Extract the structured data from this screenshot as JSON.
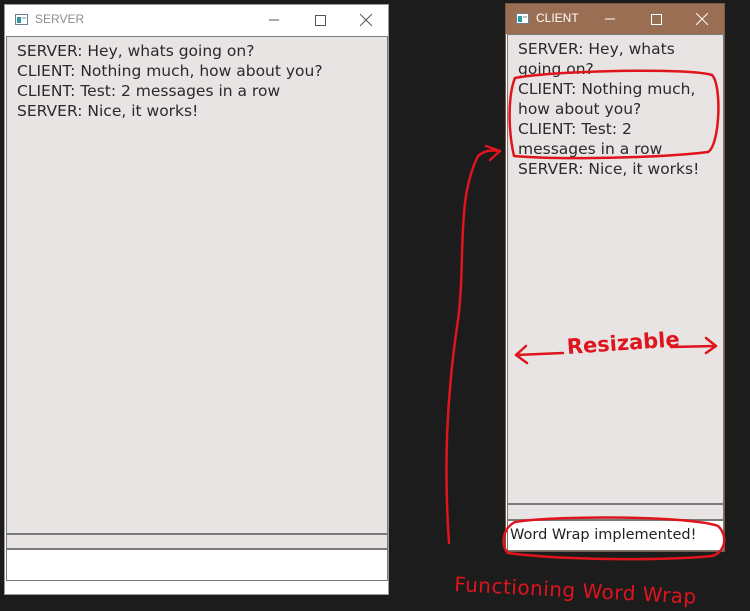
{
  "server_window": {
    "title": "SERVER",
    "messages": [
      "SERVER: Hey, whats going on?",
      "CLIENT: Nothing much, how about you?",
      "CLIENT: Test: 2 messages in a row",
      "SERVER: Nice, it works!"
    ],
    "input_value": ""
  },
  "client_window": {
    "title": "CLIENT",
    "titlebar_color": "#9a6e52",
    "messages": [
      "SERVER: Hey, whats going on?",
      "CLIENT: Nothing much, how about you?",
      "CLIENT: Test: 2 messages in a row",
      "SERVER: Nice, it works!"
    ],
    "input_value": "Word Wrap implemented!"
  },
  "annotations": {
    "resizable": "Resizable",
    "word_wrap": "Functioning Word Wrap",
    "color": "#e0141c"
  },
  "icons": [
    "app-icon",
    "minimize-icon",
    "maximize-icon",
    "close-icon"
  ]
}
